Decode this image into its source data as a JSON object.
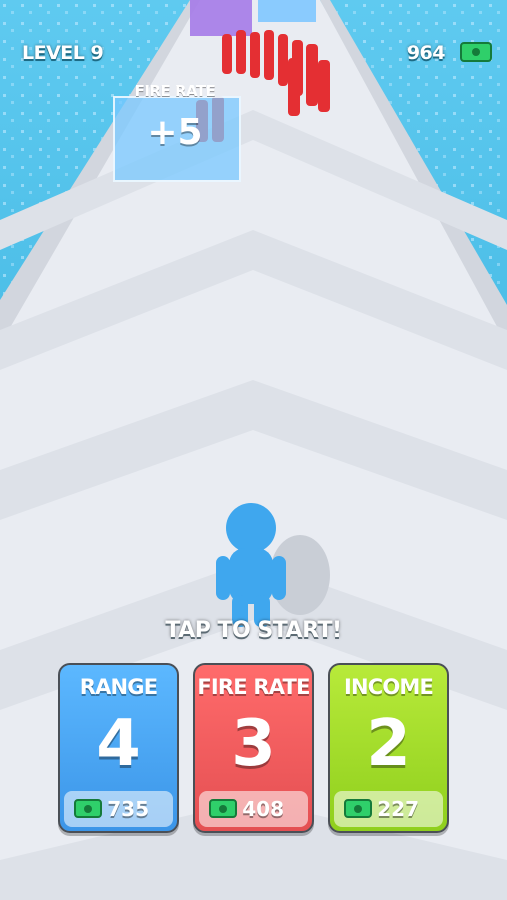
{
  "hud": {
    "level": "LEVEL 9",
    "money": "964",
    "money_icon": "cash-icon"
  },
  "gate": {
    "label": "FIRE RATE",
    "value": "+5"
  },
  "prompt": "TAP TO START!",
  "upgrades": [
    {
      "title": "RANGE",
      "value": "4",
      "price": "735",
      "color": "#4aa8f5"
    },
    {
      "title": "FIRE RATE",
      "value": "3",
      "price": "408",
      "color": "#ef5a5c"
    },
    {
      "title": "INCOME",
      "value": "2",
      "price": "227",
      "color": "#a6de2b"
    }
  ],
  "colors": {
    "sky_water": "#3fb6dc",
    "track": "#e9ecf2",
    "player": "#3fa7ee",
    "enemies": "#e42f33"
  }
}
